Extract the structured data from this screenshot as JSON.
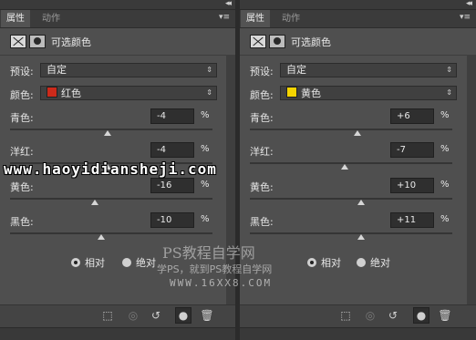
{
  "common": {
    "tab_properties": "属性",
    "tab_actions": "动作",
    "collapse_glyph": "◂◂",
    "menu_glyph": "▾≡",
    "panel_title": "可选颜色",
    "preset_label": "预设:",
    "preset_value": "自定",
    "colors_label": "颜色:",
    "percent": "%",
    "sliders": [
      "青色:",
      "洋红:",
      "黄色:",
      "黑色:"
    ],
    "radio_relative": "相对",
    "radio_absolute": "绝对",
    "select_arrows": "⇕",
    "footer_icons": {
      "clip": "⬚",
      "prev_state": "◎",
      "reset": "↺",
      "visibility": "●",
      "delete": "🗑"
    }
  },
  "left": {
    "color_name": "红色",
    "swatch_color": "#cc2a1a",
    "values": [
      "-4",
      "-4",
      "-16",
      "-10"
    ],
    "levels_fraction": [
      0.48,
      0.48,
      0.42,
      0.45
    ],
    "relative_selected": true
  },
  "right": {
    "color_name": "黄色",
    "swatch_color": "#f5d400",
    "values": [
      "+6",
      "-7",
      "+10",
      "+11"
    ],
    "levels_fraction": [
      0.53,
      0.47,
      0.55,
      0.55
    ],
    "relative_selected": true
  },
  "watermarks": {
    "url": "www.haoyidiansheji.com",
    "brand": "PS教程自学网",
    "brand_sub": "学PS，就到PS教程自学网",
    "brand_url": "WWW.16XX8.COM"
  }
}
